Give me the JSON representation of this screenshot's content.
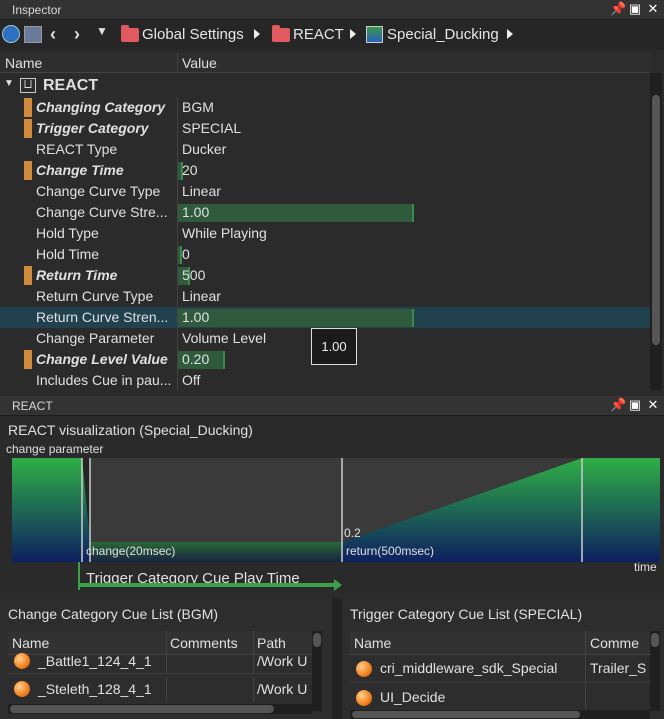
{
  "inspector": {
    "title": "Inspector",
    "breadcrumbs": [
      "Global Settings",
      "REACT",
      "Special_Ducking"
    ],
    "columns": {
      "name": "Name",
      "value": "Value"
    },
    "section": "REACT",
    "rows": [
      {
        "name": "Changing Category",
        "value": "BGM",
        "bold": true
      },
      {
        "name": "Trigger Category",
        "value": "SPECIAL",
        "bold": true
      },
      {
        "name": "REACT Type",
        "value": "Ducker",
        "bold": false
      },
      {
        "name": "Change Time",
        "value": "20",
        "bold": true
      },
      {
        "name": "Change Curve Type",
        "value": "Linear",
        "bold": false
      },
      {
        "name": "Change Curve Stre...",
        "value": "1.00",
        "bold": false
      },
      {
        "name": "Hold Type",
        "value": "While Playing",
        "bold": false
      },
      {
        "name": "Hold Time",
        "value": "0",
        "bold": false
      },
      {
        "name": "Return Time",
        "value": "500",
        "bold": true
      },
      {
        "name": "Return Curve Type",
        "value": "Linear",
        "bold": false
      },
      {
        "name": "Return Curve Stren...",
        "value": "1.00",
        "bold": false
      },
      {
        "name": "Change Parameter",
        "value": "Volume Level",
        "bold": false
      },
      {
        "name": "Change Level Value",
        "value": "0.20",
        "bold": true
      },
      {
        "name": "Includes Cue in pau...",
        "value": "Off",
        "bold": false
      }
    ],
    "bar_fractions": {
      "change_time": 0.02,
      "change_curve_strength": 1.0,
      "hold_time": 0.0,
      "return_time": 0.05,
      "return_curve_strength": 1.0,
      "change_level_value": 0.2
    },
    "tooltip": "1.00"
  },
  "react_panel": {
    "title": "REACT",
    "viz_title": "REACT visualization (Special_Ducking)",
    "y_label": "change parameter",
    "x_label": "time",
    "change_label": "change(20msec)",
    "return_label": "return(500msec)",
    "level_label": "0.2",
    "trigger_label": "Trigger Category Cue Play Time"
  },
  "change_list": {
    "title": "Change Category Cue List (BGM)",
    "columns": [
      "Name",
      "Comments",
      "Path"
    ],
    "rows": [
      {
        "name": "_Battle1_124_4_1",
        "comment": "",
        "path": "/Work U"
      },
      {
        "name": "_Steleth_128_4_1",
        "comment": "",
        "path": "/Work U"
      }
    ]
  },
  "trigger_list": {
    "title": "Trigger Category Cue List (SPECIAL)",
    "columns": [
      "Name",
      "Comme"
    ],
    "rows": [
      {
        "name": "cri_middleware_sdk_Special",
        "comment": "Trailer_S"
      },
      {
        "name": "UI_Decide",
        "comment": ""
      }
    ]
  },
  "colors": {
    "accent_mark": "#d08a3c",
    "green_bar": "#2f5a3c",
    "selection": "#22414f",
    "folder": "#e05a60"
  }
}
